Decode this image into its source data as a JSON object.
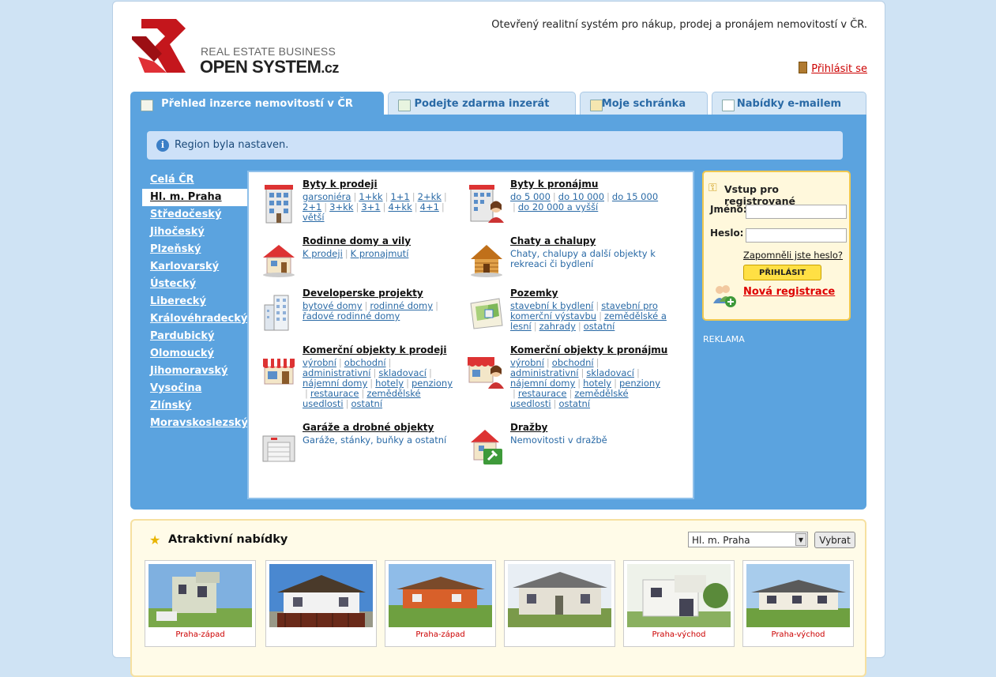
{
  "header": {
    "logo_line1": "REAL ESTATE BUSINESS",
    "logo_line2": "OPEN SYSTEM",
    "logo_suffix": ".cz",
    "tagline": "Otevřený realitní systém pro nákup, prodej a pronájem nemovitostí v ČR.",
    "login_link": "Přihlásit se"
  },
  "tabs": [
    {
      "label": "Přehled inzerce nemovitostí v ČR",
      "active": true
    },
    {
      "label": "Podejte zdarma inzerát",
      "active": false
    },
    {
      "label": "Moje schránka",
      "active": false
    },
    {
      "label": "Nabídky e-mailem",
      "active": false
    }
  ],
  "notice": "Region byla nastaven.",
  "regions": [
    "Celá ČR",
    "Hl. m. Praha",
    "Středočeský",
    "Jihočeský",
    "Plzeňský",
    "Karlovarský",
    "Ústecký",
    "Liberecký",
    "Královéhradecký",
    "Pardubický",
    "Olomoucký",
    "Jihomoravský",
    "Vysočina",
    "Zlínský",
    "Moravskoslezský"
  ],
  "selected_region": "Hl. m. Praha",
  "categories": {
    "byty_prodej": {
      "title": "Byty k prodeji",
      "links": [
        "garsoniéra",
        "1+kk",
        "1+1",
        "2+kk",
        "2+1",
        "3+kk",
        "3+1",
        "4+kk",
        "4+1",
        "větší"
      ]
    },
    "byty_pronajem": {
      "title": "Byty k pronájmu",
      "links": [
        "do 5 000",
        "do 10 000",
        "do 15 000",
        "do 20 000 a vyšší"
      ]
    },
    "domy": {
      "title": "Rodinne domy a vily",
      "links": [
        "K prodeji",
        "K pronajmutí"
      ]
    },
    "chaty": {
      "title": "Chaty a chalupy",
      "desc": "Chaty, chalupy a další objekty k rekreaci či bydlení"
    },
    "developer": {
      "title": "Developerske projekty",
      "links": [
        "bytové domy",
        "rodinné domy",
        "řadové rodinné domy"
      ]
    },
    "pozemky": {
      "title": "Pozemky",
      "links": [
        "stavební k bydlení",
        "stavební pro komerční výstavbu",
        "zemědělské a lesní",
        "zahrady",
        "ostatní"
      ]
    },
    "kom_prodej": {
      "title": "Komerční objekty k prodeji",
      "links": [
        "výrobní",
        "obchodní",
        "administrativní",
        "skladovací",
        "nájemní domy",
        "hotely",
        "penziony",
        "restaurace",
        "zemědělské usedlosti",
        "ostatní"
      ]
    },
    "kom_pronajem": {
      "title": "Komerční objekty k pronájmu",
      "links": [
        "výrobní",
        "obchodní",
        "administrativní",
        "skladovací",
        "nájemní domy",
        "hotely",
        "penziony",
        "restaurace",
        "zemědělské usedlosti",
        "ostatní"
      ]
    },
    "garaze": {
      "title": "Garáže a drobné objekty",
      "desc": "Garáže, stánky, buňky a ostatní"
    },
    "drazby": {
      "title": "Dražby",
      "desc": "Nemovitosti v dražbě"
    }
  },
  "login": {
    "title": "Vstup pro registrované",
    "name_label": "Jméno:",
    "password_label": "Heslo:",
    "forgot": "Zapomněli jste heslo?",
    "submit": "PŘIHLÁSIT",
    "register": "Nová registrace"
  },
  "reklama": "REKLAMA",
  "atraktivni": {
    "title": "Atraktivní nabídky",
    "select_value": "Hl. m. Praha",
    "button": "Vybrat",
    "captions": [
      "Praha-západ",
      "",
      "Praha-západ",
      "",
      "Praha-východ",
      "Praha-východ"
    ]
  },
  "colors": {
    "accent_blue": "#5ba3df",
    "link_blue": "#2a6aa6",
    "red": "#cc0000",
    "yellow": "#ffe044"
  }
}
